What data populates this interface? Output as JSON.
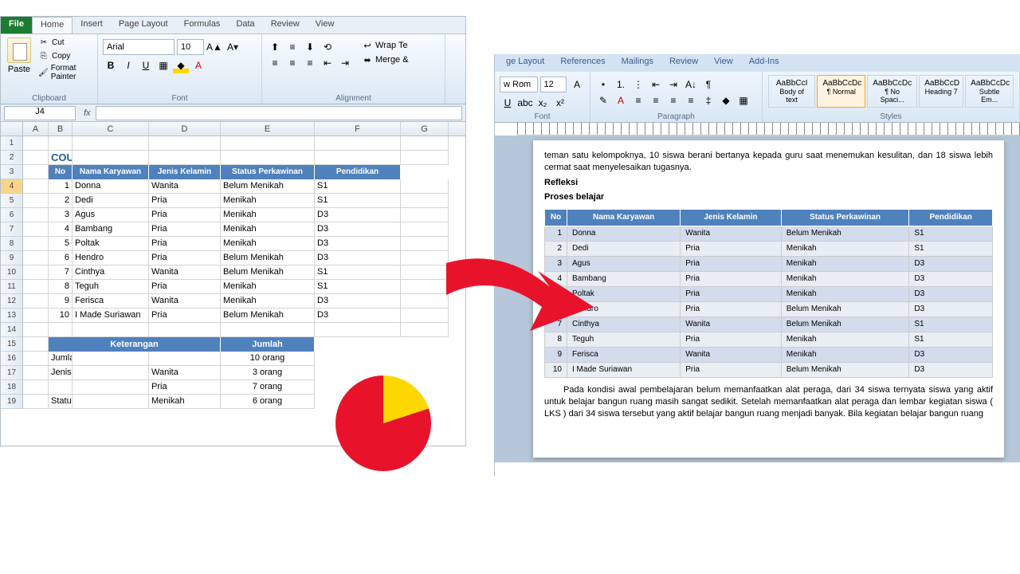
{
  "excel": {
    "tabs": [
      "File",
      "Home",
      "Insert",
      "Page Layout",
      "Formulas",
      "Data",
      "Review",
      "View"
    ],
    "clipboard": {
      "label": "Clipboard",
      "paste": "Paste",
      "cut": "Cut",
      "copy": "Copy",
      "painter": "Format Painter"
    },
    "font": {
      "label": "Font",
      "name": "Arial",
      "size": "10"
    },
    "alignment": {
      "label": "Alignment",
      "wrap": "Wrap Te",
      "merge": "Merge &"
    },
    "nameBox": "J4",
    "cols": [
      "A",
      "B",
      "C",
      "D",
      "E",
      "F",
      "G"
    ],
    "title": "COUNTIF",
    "headers": {
      "no": "No",
      "nama": "Nama Karyawan",
      "jk": "Jenis Kelamin",
      "sp": "Status Perkawinan",
      "pend": "Pendidikan"
    },
    "rows": [
      {
        "n": "1",
        "nama": "Donna",
        "jk": "Wanita",
        "sp": "Belum Menikah",
        "p": "S1"
      },
      {
        "n": "2",
        "nama": "Dedi",
        "jk": "Pria",
        "sp": "Menikah",
        "p": "S1"
      },
      {
        "n": "3",
        "nama": "Agus",
        "jk": "Pria",
        "sp": "Menikah",
        "p": "D3"
      },
      {
        "n": "4",
        "nama": "Bambang",
        "jk": "Pria",
        "sp": "Menikah",
        "p": "D3"
      },
      {
        "n": "5",
        "nama": "Poltak",
        "jk": "Pria",
        "sp": "Menikah",
        "p": "D3"
      },
      {
        "n": "6",
        "nama": "Hendro",
        "jk": "Pria",
        "sp": "Belum Menikah",
        "p": "D3"
      },
      {
        "n": "7",
        "nama": "Cinthya",
        "jk": "Wanita",
        "sp": "Belum Menikah",
        "p": "S1"
      },
      {
        "n": "8",
        "nama": "Teguh",
        "jk": "Pria",
        "sp": "Menikah",
        "p": "S1"
      },
      {
        "n": "9",
        "nama": "Ferisca",
        "jk": "Wanita",
        "sp": "Menikah",
        "p": "D3"
      },
      {
        "n": "10",
        "nama": "I Made Suriawan",
        "jk": "Pria",
        "sp": "Belum Menikah",
        "p": "D3"
      }
    ],
    "summary": {
      "ket": "Keterangan",
      "jml": "Jumlah",
      "r1": {
        "k": "Jumlah Karyawan",
        "v": "10 orang"
      },
      "r2": {
        "k": "Jenis Kelamin",
        "s": "Wanita",
        "v": "3 orang"
      },
      "r3": {
        "s": "Pria",
        "v": "7 orang"
      },
      "r4": {
        "k": "Status Perkawinan",
        "s": "Menikah",
        "v": "6 orang"
      }
    }
  },
  "word": {
    "tabs": [
      "ge Layout",
      "References",
      "Mailings",
      "Review",
      "View",
      "Add-Ins"
    ],
    "font": {
      "name": "w Rom",
      "size": "12",
      "label": "Font"
    },
    "para": {
      "label": "Paragraph"
    },
    "styles": {
      "label": "Styles",
      "items": [
        "AaBbCcI",
        "AaBbCcDc",
        "AaBbCcDc",
        "AaBbCcD",
        "AaBbCcDc"
      ],
      "names": [
        "Body of text",
        "¶ Normal",
        "¶ No Spaci...",
        "Heading 7",
        "Subtle Em..."
      ]
    },
    "para1": "teman satu kelompoknya, 10 siswa berani bertanya kepada guru saat menemukan kesulitan, dan 18 siswa lebih cermat saat menyelesaikan tugasnya.",
    "h1": "Refleksi",
    "h2": "Proses belajar",
    "para2": "Pada kondisi awal pembelajaran belum memanfaatkan  alat peraga, dari 34 siswa ternyata siswa yang aktif untuk belajar bangun ruang masih sangat sedikit. Setelah memanfaatkan alat peraga dan lembar kegiatan siswa ( LKS ) dari 34 siswa tersebut yang aktif belajar bangun ruang menjadi  banyak. Bila kegiatan belajar bangun ruang"
  },
  "chart_data": {
    "type": "pie",
    "title": "",
    "series": [
      {
        "name": "",
        "values": [
          20,
          80
        ]
      }
    ],
    "categories": [
      "Yellow",
      "Red"
    ]
  }
}
